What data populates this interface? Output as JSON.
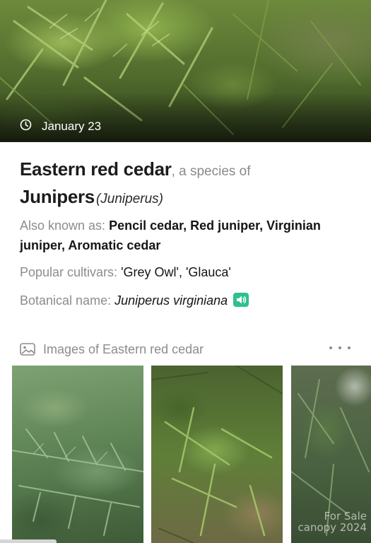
{
  "hero": {
    "date": "January 23",
    "icon": "clock-icon"
  },
  "plant": {
    "common_name": "Eastern red cedar",
    "species_of_text": ", a species of",
    "genus_common": "Junipers",
    "genus_latin": "(Juniperus)"
  },
  "details": {
    "aka_label": "Also known as:",
    "aka_value": "Pencil cedar, Red juniper, Virginian juniper, Aromatic cedar",
    "cultivars_label": "Popular cultivars:",
    "cultivars_value": "'Grey Owl', 'Glauca'",
    "botanical_label": "Botanical name:",
    "botanical_value": "Juniperus virginiana",
    "speaker_icon": "speaker-icon",
    "speaker_color": "#2fbf8f"
  },
  "images": {
    "title": "Images of Eastern red cedar",
    "header_icon": "image-icon",
    "more_icon": "more-dots-icon",
    "watermark": "For Sale\ncanopy 2024"
  }
}
